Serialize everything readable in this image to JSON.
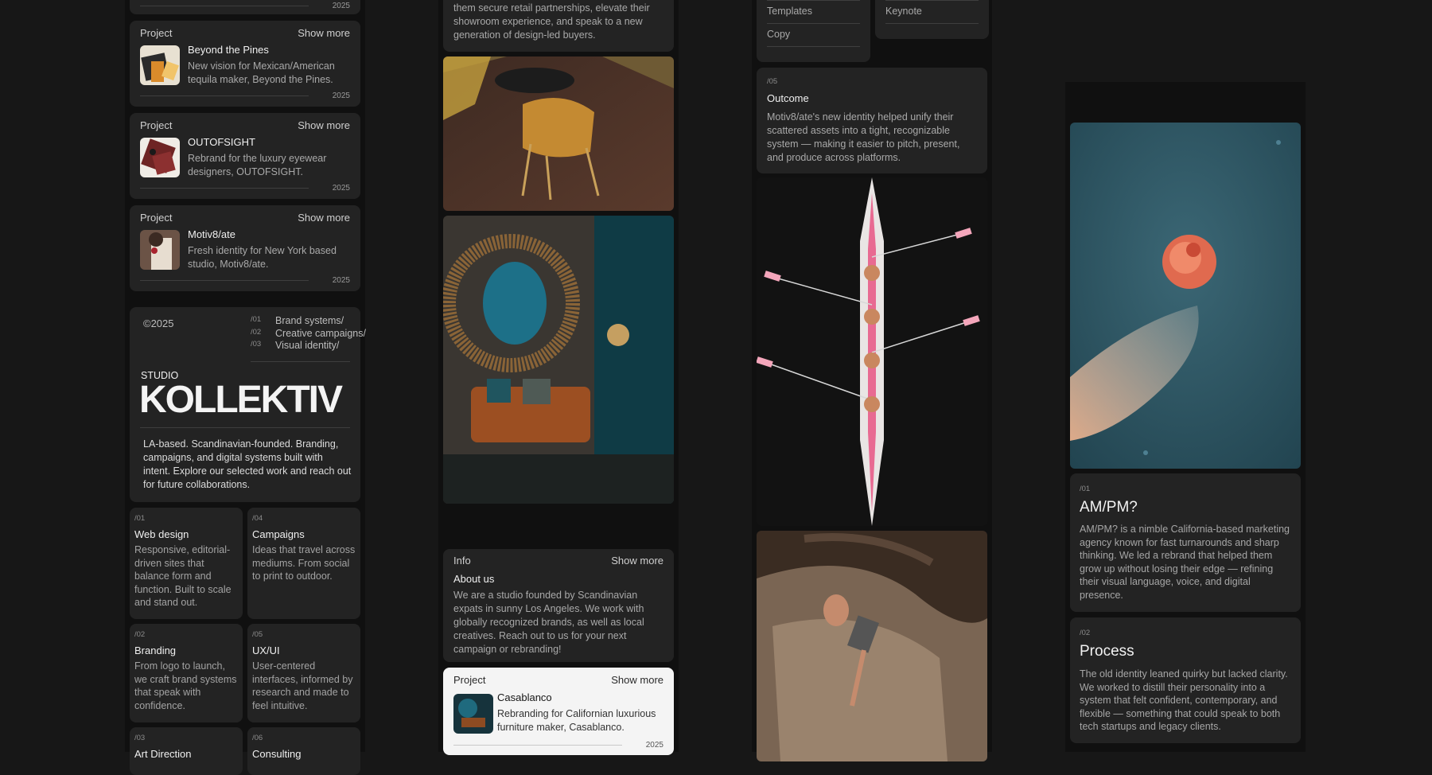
{
  "col1": {
    "top_card": {
      "year": "2025"
    },
    "projects": [
      {
        "label": "Project",
        "more": "Show more",
        "title": "Beyond the Pines",
        "desc": "New vision for Mexican/American tequila maker, Beyond the Pines.",
        "year": "2025"
      },
      {
        "label": "Project",
        "more": "Show more",
        "title": "OUTOFSIGHT",
        "desc": "Rebrand for the luxury eyewear designers, OUTOFSIGHT.",
        "year": "2025"
      },
      {
        "label": "Project",
        "more": "Show more",
        "title": "Motiv8/ate",
        "desc": "Fresh identity for New York based studio, Motiv8/ate.",
        "year": "2025"
      }
    ],
    "studio": {
      "copyright": "©2025",
      "nav": [
        {
          "num": "/01",
          "label": "Brand systems/"
        },
        {
          "num": "/02",
          "label": "Creative campaigns/"
        },
        {
          "num": "/03",
          "label": "Visual identity/"
        }
      ],
      "small": "STUDIO",
      "big": "KOLLEKTIV",
      "desc": "LA-based. Scandinavian-founded. Branding, campaigns, and digital systems built with intent. Explore our selected work and reach out for future collaborations."
    },
    "services": [
      {
        "num": "/01",
        "title": "Web design",
        "desc": "Responsive, editorial-driven sites that balance form and function. Built to scale and stand out."
      },
      {
        "num": "/04",
        "title": "Campaigns",
        "desc": "Ideas that travel across mediums. From social to print to outdoor."
      },
      {
        "num": "/02",
        "title": "Branding",
        "desc": "From logo to launch, we craft brand systems that speak with confidence."
      },
      {
        "num": "/05",
        "title": "UX/UI",
        "desc": "User-centered interfaces, informed by research and made to feel intuitive."
      },
      {
        "num": "/03",
        "title": "Art Direction",
        "desc": ""
      },
      {
        "num": "/06",
        "title": "Consulting",
        "desc": ""
      }
    ]
  },
  "col2": {
    "top_text": "them secure retail partnerships, elevate their showroom experience, and speak to a new generation of design-led buyers.",
    "info": {
      "label": "Info",
      "more": "Show more",
      "title": "About us",
      "desc": "We are a studio founded by Scandinavian expats in sunny Los Angeles. We work with globally recognized brands, as well as local creatives. Reach out to us for your next campaign or rebranding!"
    },
    "project": {
      "label": "Project",
      "more": "Show more",
      "title": "Casablanco",
      "desc": "Rebranding for Californian luxurious furniture maker, Casablanco.",
      "year": "2025"
    }
  },
  "col3": {
    "tools_left": [
      "Templates",
      "Copy"
    ],
    "tools_right": [
      "Keynote"
    ],
    "outcome": {
      "num": "/05",
      "title": "Outcome",
      "desc": "Motiv8/ate's new identity helped unify their scattered assets into a tight, recognizable system — making it easier to pitch, present, and produce across platforms."
    }
  },
  "col4": {
    "ampm": {
      "num": "/01",
      "title": "AM/PM?",
      "desc": "AM/PM? is a nimble California-based marketing agency known for fast turnarounds and sharp thinking. We led a rebrand that helped them grow up without losing their edge — refining their visual language, voice, and digital presence."
    },
    "process": {
      "num": "/02",
      "title": "Process",
      "desc": "The old identity leaned quirky but lacked clarity. We worked to distill their personality into a system that felt confident, contemporary, and flexible — something that could speak to both tech startups and legacy clients."
    }
  }
}
